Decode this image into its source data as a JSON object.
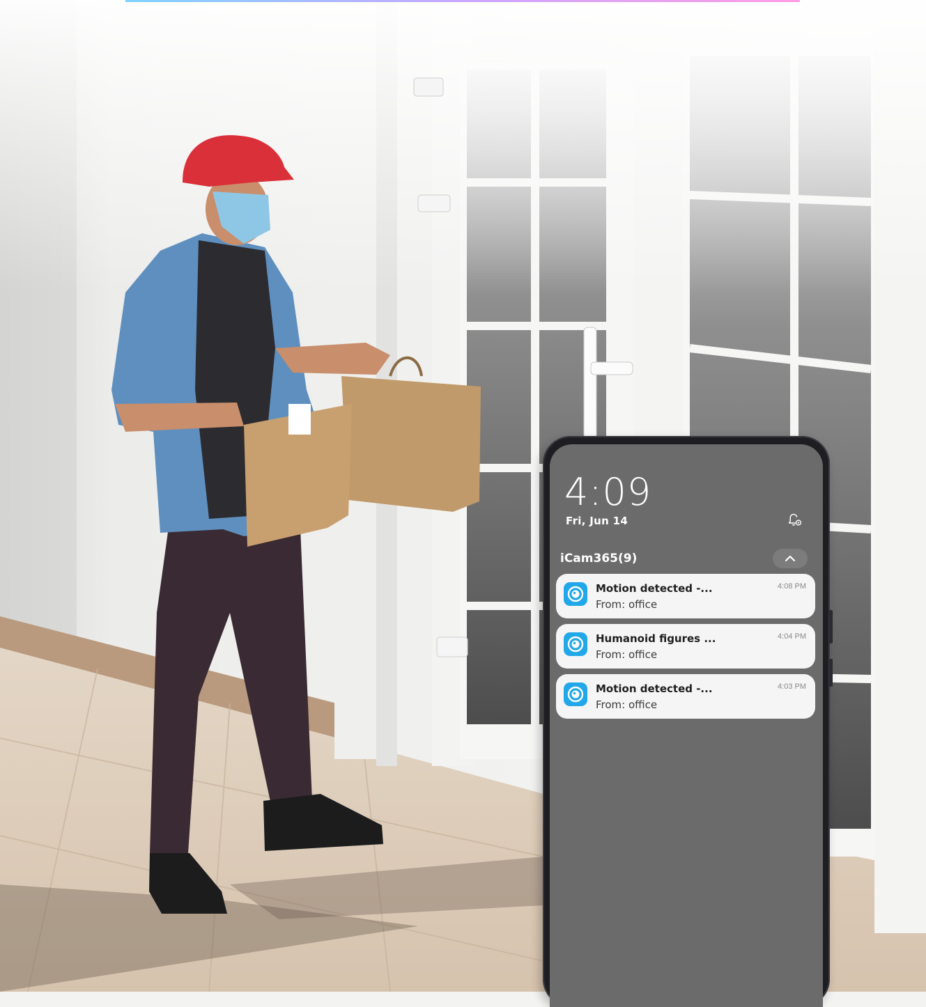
{
  "lockscreen": {
    "time": "4:09",
    "date": "Fri, Jun 14"
  },
  "notification_group": {
    "app_name": "iCam365(9)",
    "notifications": [
      {
        "title": "Motion detected -...",
        "subtitle": "From: office",
        "time": "4:08 PM"
      },
      {
        "title": "Humanoid figures ...",
        "subtitle": "From: office",
        "time": "4:04 PM"
      },
      {
        "title": "Motion detected -...",
        "subtitle": "From: office",
        "time": "4:03 PM"
      }
    ]
  },
  "icons": {
    "notification_settings": "bell-gear-icon",
    "collapse": "chevron-up-icon",
    "app": "camera-lens-icon"
  },
  "colors": {
    "app_icon": "#22a8e8",
    "screen_background": "#6b6b6b",
    "notification_card": "#f5f5f5"
  }
}
